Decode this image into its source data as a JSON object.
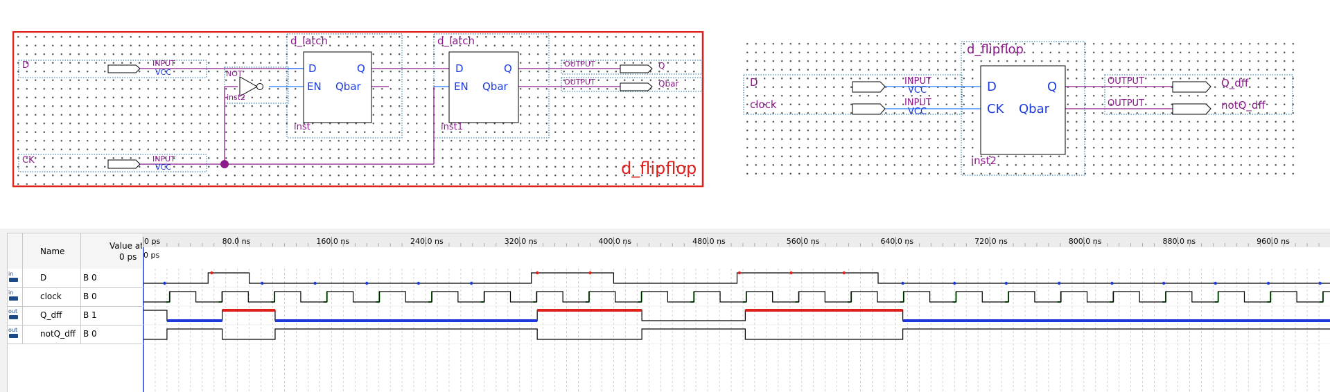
{
  "schematic_left": {
    "title": "d_flipflop",
    "border_color": "#e0201a",
    "pin_color": "#8b1a8b",
    "wire_color": "#1e78ff",
    "inputs": [
      {
        "name": "D",
        "type": "INPUT",
        "default": "VCC"
      },
      {
        "name": "CK",
        "type": "INPUT",
        "default": "VCC"
      }
    ],
    "not_gate": {
      "label": "NOT",
      "instance": "inst2"
    },
    "latch1": {
      "title": "d_latch",
      "instance": "inst",
      "pins": [
        "D",
        "EN",
        "Q",
        "Qbar"
      ]
    },
    "latch2": {
      "title": "d_latch",
      "instance": "inst1",
      "pins": [
        "D",
        "EN",
        "Q",
        "Qbar"
      ]
    },
    "outputs": [
      {
        "name": "Q",
        "type": "OUTPUT"
      },
      {
        "name": "Qbar",
        "type": "OUTPUT"
      }
    ]
  },
  "schematic_right": {
    "block_title": "d_flipflop",
    "instance": "inst2",
    "pins": [
      "D",
      "CK",
      "Q",
      "Qbar"
    ],
    "inputs": [
      {
        "name": "D",
        "type": "INPUT",
        "default": "VCC"
      },
      {
        "name": "clock",
        "type": "INPUT",
        "default": "VCC"
      }
    ],
    "outputs": [
      {
        "name": "Q_dff",
        "type": "OUTPUT"
      },
      {
        "name": "notQ_dff",
        "type": "OUTPUT"
      }
    ]
  },
  "waveform": {
    "headers": {
      "name": "Name",
      "value_line1": "Value at",
      "value_line2": "0 ps"
    },
    "cursor_label": "0 ps",
    "time_axis": {
      "start": "0 ps",
      "ticks": [
        "80.0 ns",
        "160.0 ns",
        "240.0 ns",
        "320.0 ns",
        "400.0 ns",
        "480.0 ns",
        "560.0 ns",
        "640.0 ns",
        "720.0 ns",
        "800.0 ns",
        "880.0 ns",
        "960.0 ns"
      ]
    },
    "rows": [
      {
        "dir": "in",
        "name": "D",
        "value": "B 0"
      },
      {
        "dir": "in",
        "name": "clock",
        "value": "B 0"
      },
      {
        "dir": "out",
        "name": "Q_dff",
        "value": "B 1"
      },
      {
        "dir": "out",
        "name": "notQ_dff",
        "value": "B 0"
      }
    ],
    "colors": {
      "clock_edge": "#1a9a1a",
      "high": "#e0201a",
      "low": "#1a3ae0",
      "trace": "#000000"
    }
  }
}
